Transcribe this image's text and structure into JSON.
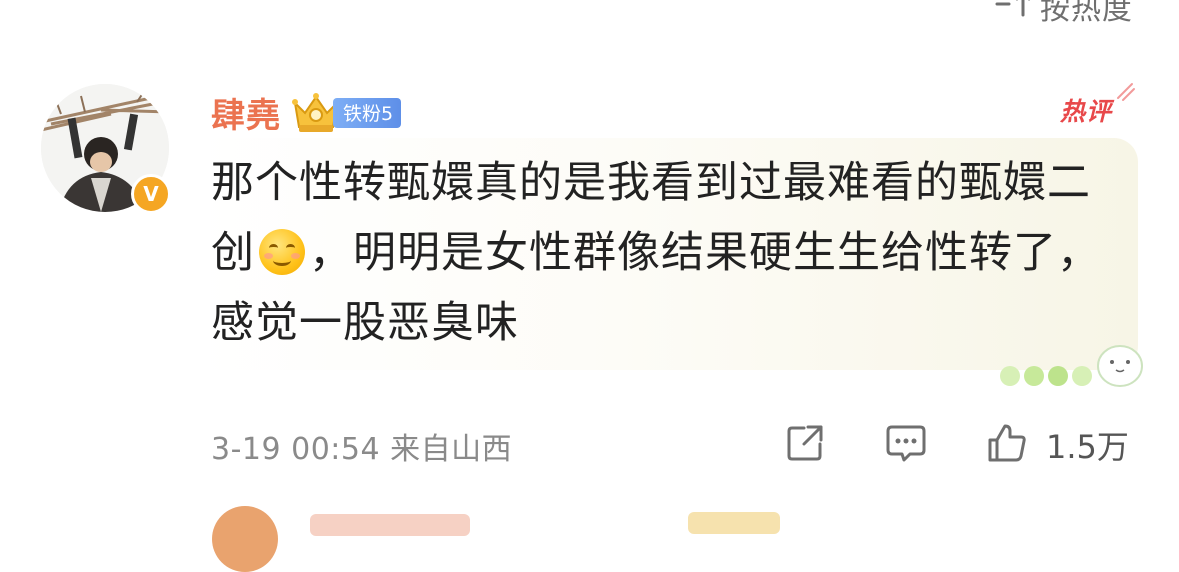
{
  "sort": {
    "label": "按热度",
    "icon": "sort-lines-icon"
  },
  "comment": {
    "username": "肆堯",
    "fan_badge": "铁粉5",
    "hot_tag": "热评",
    "text_part1": "那个性转甄嬛真的是我看到过最难看的甄嬛二创",
    "emoji": "smiling-blush-emoji",
    "text_part2": "，明明是女性群像结果硬生生给性转了，感觉一股恶臭味",
    "meta": "3-19 00:54 来自山西",
    "like_count": "1.5万"
  },
  "colors": {
    "username": "#eb7350",
    "hot_tag": "#e8484a",
    "fan_badge": "#6f9ff0",
    "verified": "#f5a623"
  }
}
